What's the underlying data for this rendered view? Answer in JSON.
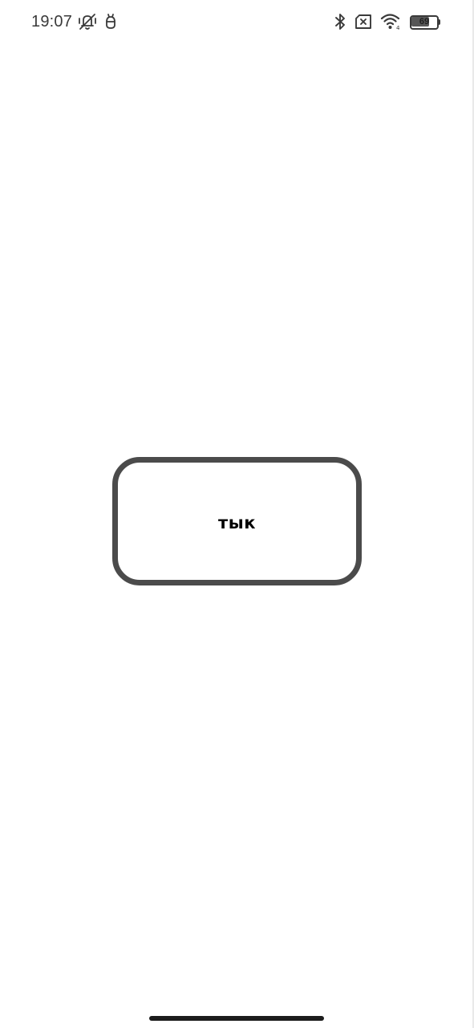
{
  "status_bar": {
    "time": "19:07",
    "battery_level": "69",
    "battery_fraction": 0.69,
    "icons": {
      "left": [
        "vibrate-silent-icon",
        "android-debug-icon"
      ],
      "right": [
        "bluetooth-icon",
        "no-sim-icon",
        "wifi-icon",
        "battery-icon"
      ]
    }
  },
  "main": {
    "button_label": "тык"
  },
  "colors": {
    "background": "#ffffff",
    "button_border": "#4b4b4b",
    "text": "#000000",
    "status_icons": "#3a3a3a"
  }
}
